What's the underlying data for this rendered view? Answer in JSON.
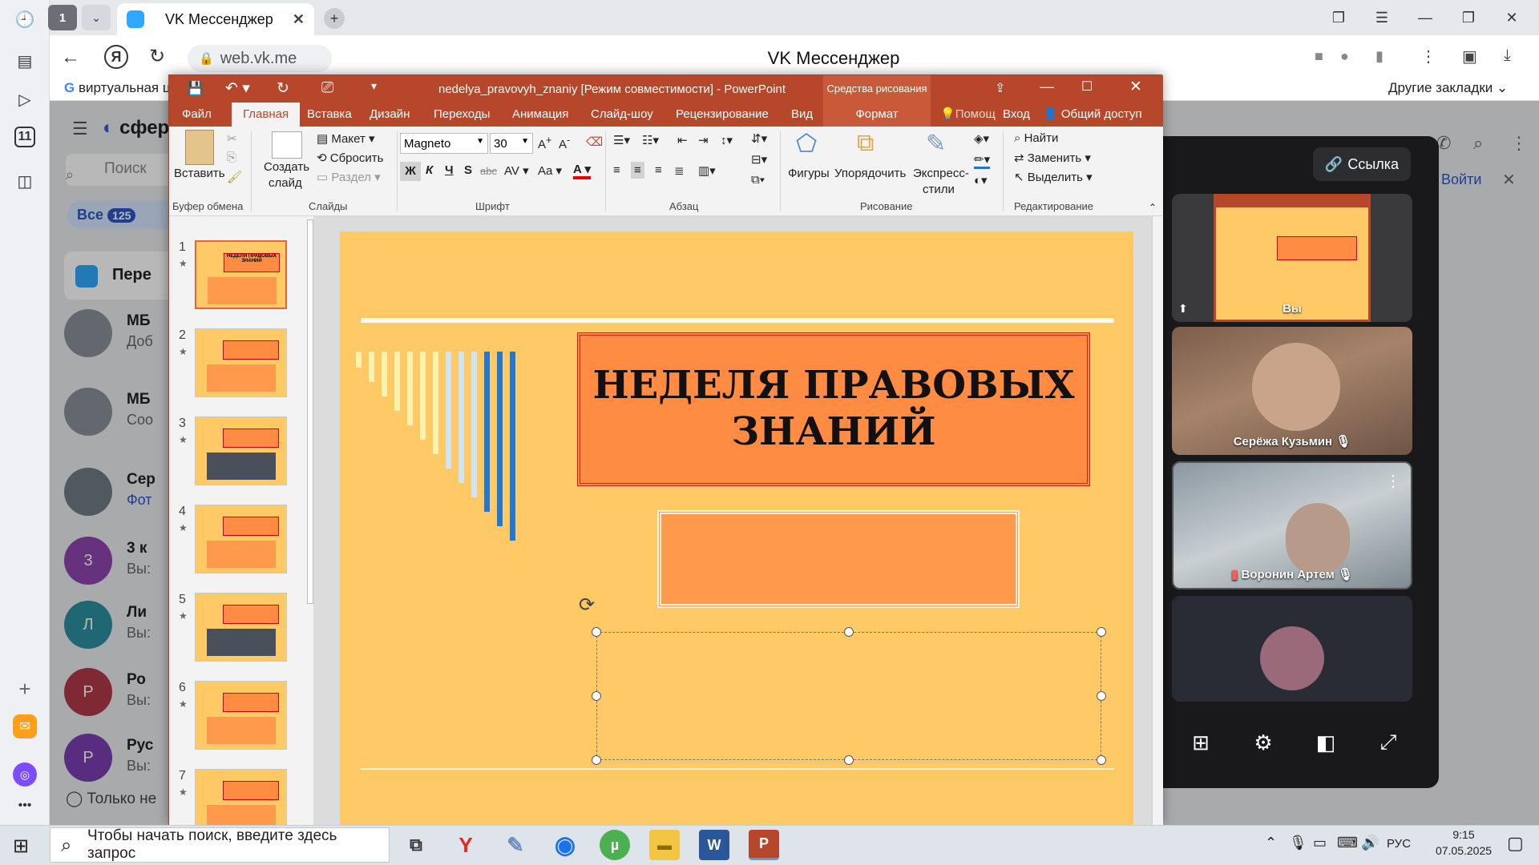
{
  "browser": {
    "tab_count": "1",
    "tab_title": "VK Мессенджер",
    "address": "web.vk.me",
    "page_title": "VK Мессенджер",
    "bookmark_first": "виртуальная ц",
    "bookmark_other": "Другие закладки"
  },
  "sidebar": {
    "badge_number": "11"
  },
  "vk": {
    "logo_text": "сфер",
    "search_placeholder": "Поиск",
    "filter_all": "Все",
    "filter_count": "125",
    "pinned": "Пере",
    "login": "Войти",
    "bottom_text": "Только не",
    "chats": [
      {
        "name": "МБ",
        "preview": "Доб",
        "initial": "",
        "color": "#8a9099"
      },
      {
        "name": "МБ",
        "preview": "Соо",
        "initial": "",
        "color": "#8a9099"
      },
      {
        "name": "Сер",
        "preview": "Фот",
        "initial": "",
        "color": "#6f7a85"
      },
      {
        "name": "3 к",
        "preview": "Вы:",
        "initial": "3",
        "color": "#8e44ad"
      },
      {
        "name": "Ли",
        "preview": "Вы:",
        "initial": "Л",
        "color": "#2a8fa0"
      },
      {
        "name": "Ро",
        "preview": "Вы:",
        "initial": "Р",
        "color": "#b03a48"
      },
      {
        "name": "Рус",
        "preview": "Вы:",
        "initial": "Р",
        "color": "#7b3fb0"
      }
    ]
  },
  "call": {
    "link_button": "Ссылка",
    "tiles": [
      {
        "label": "Вы"
      },
      {
        "label": "Серёжа Кузьмин"
      },
      {
        "label": "Воронин Артем"
      },
      {
        "label": ""
      }
    ]
  },
  "ppt": {
    "window_title": "nedelya_pravovyh_znaniy [Режим совместимости] - PowerPoint",
    "context_tab": "Средства рисования",
    "tabs": [
      "Файл",
      "Главная",
      "Вставка",
      "Дизайн",
      "Переходы",
      "Анимация",
      "Слайд-шоу",
      "Рецензирование",
      "Вид",
      "Формат"
    ],
    "help": "Помощ",
    "signin": "Вход",
    "share": "Общий доступ",
    "ribbon": {
      "paste": "Вставить",
      "clipboard": "Буфер обмена",
      "new_slide_1": "Создать",
      "new_slide_2": "слайд",
      "layout": "Макет",
      "reset": "Сбросить",
      "section": "Раздел",
      "slides": "Слайды",
      "font_name": "Magneto",
      "font_size": "30",
      "bold": "Ж",
      "italic": "К",
      "underline": "Ч",
      "shadow": "S",
      "strike": "abc",
      "font": "Шрифт",
      "paragraph": "Абзац",
      "shapes": "Фигуры",
      "arrange": "Упорядочить",
      "quick_styles_1": "Экспресс-",
      "quick_styles_2": "стили",
      "drawing": "Рисование",
      "find": "Найти",
      "replace": "Заменить",
      "select": "Выделить",
      "editing": "Редактирование"
    },
    "slide_numbers": [
      "1",
      "2",
      "3",
      "4",
      "5",
      "6",
      "7"
    ],
    "slide_title_line1": "НЕДЕЛЯ ПРАВОВЫХ",
    "slide_title_line2": "ЗНАНИЙ",
    "thumb_titles": [
      "НЕДЕЛЯ ПРАВОВЫХ ЗНАНИЙ",
      "",
      "",
      "",
      "",
      "",
      ""
    ]
  },
  "taskbar": {
    "search_placeholder": "Чтобы начать поиск, введите здесь запрос",
    "lang": "РУС",
    "time": "9:15",
    "date": "07.05.2025"
  },
  "colors": {
    "ppt_accent": "#b7472a",
    "slide_bg": "#ffc966",
    "slide_box": "#ff8c42",
    "stripe_light": "#fff1b0",
    "stripe_blue_light": "#cde5f5",
    "stripe_blue": "#1f78d1"
  }
}
